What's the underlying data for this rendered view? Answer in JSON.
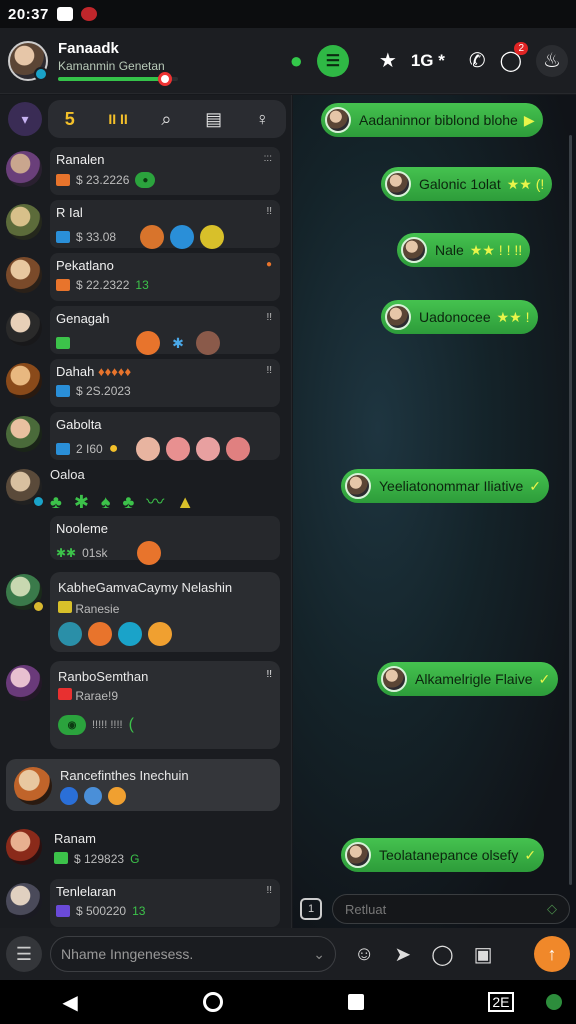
{
  "status_bar": {
    "time": "20:37"
  },
  "header": {
    "title": "Fanaadk",
    "subtitle": "Kamanmin Genetan",
    "progress": 0.88,
    "star_label": "★",
    "count_label": "1G *",
    "badge": "2",
    "icons": [
      "avatar",
      "thumb-icon",
      "chat-icon",
      "star-icon",
      "phone-icon",
      "whatsapp-icon",
      "flame-icon"
    ]
  },
  "toolbar": {
    "filter_label": "5",
    "bars_label": "II II"
  },
  "chats": [
    {
      "name": "Ranalen",
      "meta": "$ 23.2226",
      "time": ":::"
    },
    {
      "name": "R   Ial",
      "meta": "$ 33.08",
      "time": "!!"
    },
    {
      "name": "Pekatlano",
      "meta": "$ 22.2322",
      "time": "",
      "gp": "13"
    },
    {
      "name": "Genagah",
      "meta": "",
      "time": "!!"
    },
    {
      "name": "Dahah",
      "meta": "$ 2S.2023",
      "time": "!!"
    },
    {
      "name": "Gabolta",
      "meta": "2 I60",
      "time": ""
    },
    {
      "name": "Oaloa",
      "meta": "",
      "time": ""
    },
    {
      "name": "Nooleme",
      "meta": "01sk",
      "time": ""
    }
  ],
  "cards": [
    {
      "name": "KabheGamvaCaymy Nelashin",
      "meta": "Ranesie",
      "time": ""
    },
    {
      "name": "RanboSemthan",
      "meta": "Rarae!9",
      "time": "!!"
    },
    {
      "name": "Rancefinthes Inechuin",
      "meta": "",
      "time": ""
    },
    {
      "name": "Ranam",
      "meta": "$ 129823",
      "time": "",
      "gp": "G"
    },
    {
      "name": "Tenlelaran",
      "meta": "$ 500220",
      "time": "!!",
      "gp": "13"
    }
  ],
  "messages": [
    {
      "text": "Aadaninnor biblond blohe",
      "ext": "▶"
    },
    {
      "text": "Galonic 1olat",
      "ext": "★★ (!"
    },
    {
      "text": "Nale",
      "ext": "★★ ! ! !!"
    },
    {
      "text": "Uadonocee",
      "ext": "★★ !"
    },
    {
      "text": "Yeeliatonommar Iliative",
      "ext": "✓"
    },
    {
      "text": "Alkamelrigle Flaive",
      "ext": "✓"
    },
    {
      "text": "Teolatanepance olsefy",
      "ext": "✓"
    }
  ],
  "compose": {
    "placeholder": "Retluat",
    "icon": "1"
  },
  "bottom": {
    "placeholder": "Nhame Inngenesess."
  }
}
